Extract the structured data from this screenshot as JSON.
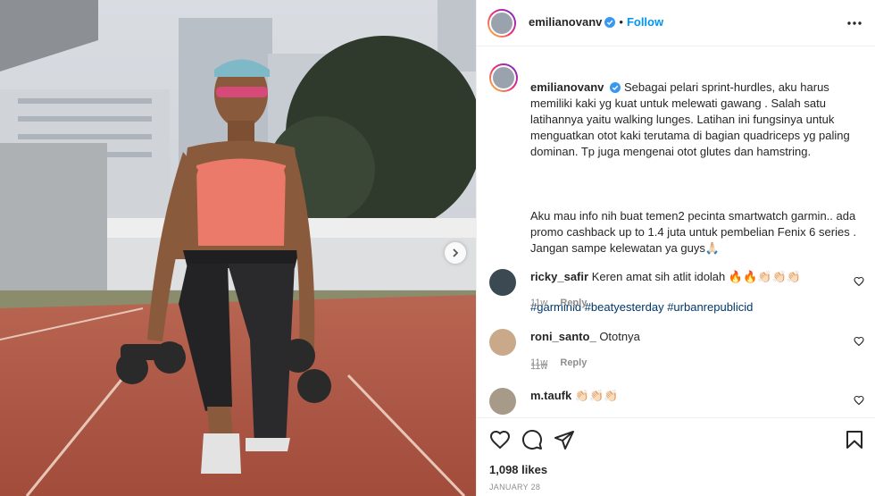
{
  "post": {
    "author": "emilianovanv",
    "follow_label": "Follow",
    "separator": "•",
    "caption_paragraph_1": "Sebagai pelari sprint-hurdles, aku harus memiliki kaki yg kuat untuk melewati gawang . Salah satu latihannya yaitu walking lunges. Latihan ini fungsinya untuk menguatkan otot kaki terutama di bagian quadriceps yg paling dominan. Tp juga mengenai otot glutes dan hamstring.",
    "caption_paragraph_2": "Aku mau info nih buat temen2 pecinta smartwatch garmin.. ada promo cashback up to 1.4 juta untuk pembelian Fenix 6 series . Jangan sampe kelewatan ya guys🙏🏻",
    "hashtags": "#garminid #beatyesterday #urbanrepublicid",
    "caption_age": "11w",
    "likes": "1,098 likes",
    "date": "JANUARY 28"
  },
  "comments": [
    {
      "user": "ricky_safir",
      "text": "Keren amat sih atlit idolah 🔥🔥👏🏻👏🏻👏🏻",
      "age": "11w",
      "reply": "Reply"
    },
    {
      "user": "roni_santo_",
      "text": "Ototnya",
      "age": "11w",
      "reply": "Reply"
    },
    {
      "user": "m.taufk",
      "text": "👏🏻👏🏻👏🏻",
      "age": "",
      "reply": ""
    }
  ],
  "icons": {
    "verified": "verified-badge-icon",
    "more": "more-options-icon",
    "like": "heart-icon",
    "comment": "comment-icon",
    "share": "share-icon",
    "save": "bookmark-icon",
    "next": "chevron-right-icon"
  },
  "colors": {
    "link_blue": "#0095f6",
    "hashtag": "#00376b",
    "muted": "#8e8e8e",
    "border": "#efefef"
  }
}
